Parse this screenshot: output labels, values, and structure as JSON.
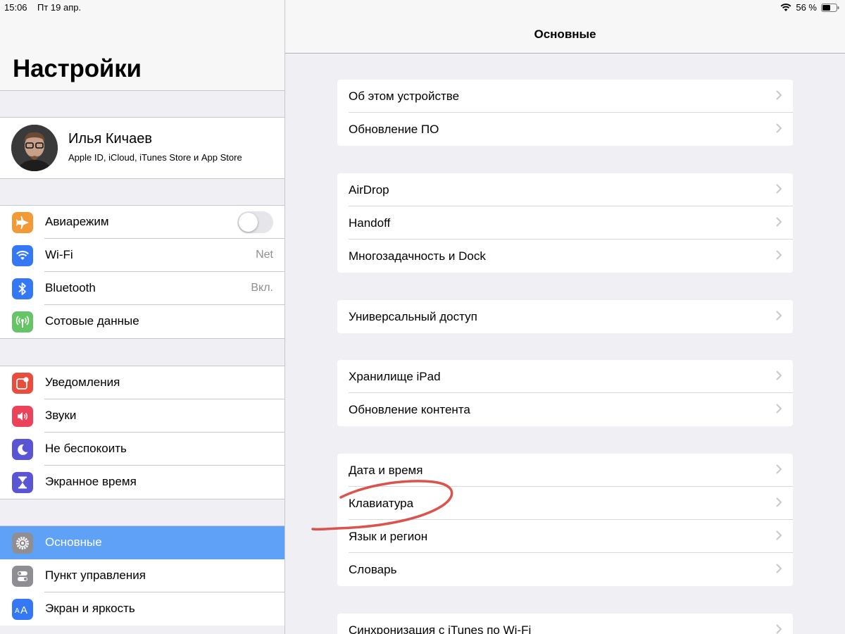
{
  "status": {
    "time": "15:06",
    "date": "Пт 19 апр.",
    "battery": "56 %"
  },
  "sidebar": {
    "title": "Настройки",
    "profile": {
      "name": "Илья Кичаев",
      "subtitle": "Apple ID, iCloud, iTunes Store и App Store"
    },
    "group1": [
      {
        "label": "Авиарежим",
        "icon": "airplane-icon",
        "color": "#f19a37",
        "toggle": false
      },
      {
        "label": "Wi-Fi",
        "icon": "wifi-icon",
        "color": "#3478f6",
        "value": "Net"
      },
      {
        "label": "Bluetooth",
        "icon": "bluetooth-icon",
        "color": "#3478f6",
        "value": "Вкл."
      },
      {
        "label": "Сотовые данные",
        "icon": "cellular-icon",
        "color": "#65c466"
      }
    ],
    "group2": [
      {
        "label": "Уведомления",
        "icon": "notifications-icon",
        "color": "#eb4d3d"
      },
      {
        "label": "Звуки",
        "icon": "sounds-icon",
        "color": "#eb445a"
      },
      {
        "label": "Не беспокоить",
        "icon": "moon-icon",
        "color": "#5956d6"
      },
      {
        "label": "Экранное время",
        "icon": "hourglass-icon",
        "color": "#5956d6"
      }
    ],
    "group3": [
      {
        "label": "Основные",
        "icon": "gear-icon",
        "color": "#8e8e93",
        "selected": true
      },
      {
        "label": "Пункт управления",
        "icon": "switches-icon",
        "color": "#8e8e93"
      },
      {
        "label": "Экран и яркость",
        "icon": "display-icon",
        "color": "#3478f6"
      }
    ]
  },
  "detail": {
    "title": "Основные",
    "groups": [
      [
        "Об этом устройстве",
        "Обновление ПО"
      ],
      [
        "AirDrop",
        "Handoff",
        "Многозадачность и Dock"
      ],
      [
        "Универсальный доступ"
      ],
      [
        "Хранилище iPad",
        "Обновление контента"
      ],
      [
        "Дата и время",
        "Клавиатура",
        "Язык и регион",
        "Словарь"
      ],
      [
        "Синхронизация с iTunes по Wi-Fi"
      ]
    ]
  },
  "colors": {
    "selection": "#5fa1f7",
    "annotation": "#d7443e"
  }
}
